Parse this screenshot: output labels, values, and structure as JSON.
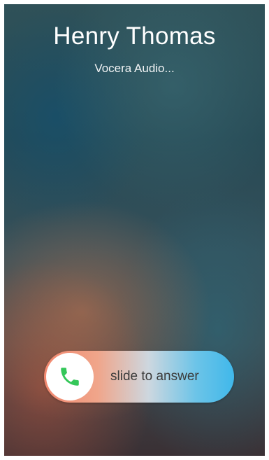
{
  "call": {
    "caller_name": "Henry Thomas",
    "status": "Vocera Audio..."
  },
  "answer_slider": {
    "label": "slide to answer",
    "knob_icon": "phone-icon",
    "knob_icon_color": "#34c759",
    "track_colors": [
      "#f2886f",
      "#40b8ea"
    ]
  }
}
